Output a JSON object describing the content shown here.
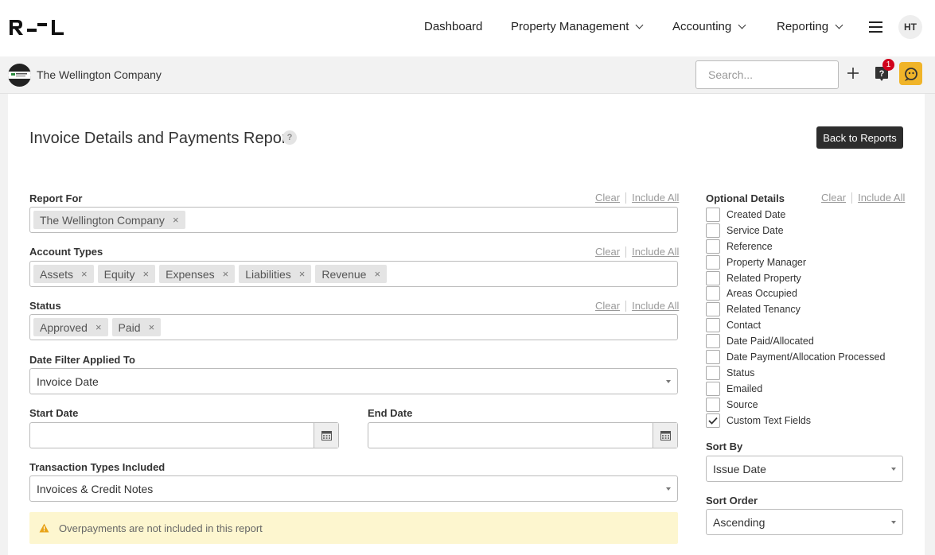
{
  "nav": {
    "items": [
      "Dashboard",
      "Property Management",
      "Accounting",
      "Reporting"
    ],
    "user_initials": "HT"
  },
  "company": {
    "name": "The Wellington Company",
    "search_placeholder": "Search...",
    "notification_count": "1"
  },
  "report": {
    "title": "Invoice Details and Payments Report",
    "help": "?",
    "back_label": "Back to Reports",
    "clear_label": "Clear",
    "include_all_label": "Include All",
    "report_for": {
      "label": "Report For",
      "tags": [
        "The Wellington Company"
      ]
    },
    "account_types": {
      "label": "Account Types",
      "tags": [
        "Assets",
        "Equity",
        "Expenses",
        "Liabilities",
        "Revenue"
      ]
    },
    "status": {
      "label": "Status",
      "tags": [
        "Approved",
        "Paid"
      ]
    },
    "date_filter": {
      "label": "Date Filter Applied To",
      "value": "Invoice Date"
    },
    "start_date": {
      "label": "Start Date",
      "value": ""
    },
    "end_date": {
      "label": "End Date",
      "value": ""
    },
    "transaction_types": {
      "label": "Transaction Types Included",
      "value": "Invoices & Credit Notes"
    },
    "alert": "Overpayments are not included in this report"
  },
  "optional_details": {
    "label": "Optional Details",
    "items": [
      {
        "label": "Created Date",
        "checked": false
      },
      {
        "label": "Service Date",
        "checked": false
      },
      {
        "label": "Reference",
        "checked": false
      },
      {
        "label": "Property Manager",
        "checked": false
      },
      {
        "label": "Related Property",
        "checked": false
      },
      {
        "label": "Areas Occupied",
        "checked": false
      },
      {
        "label": "Related Tenancy",
        "checked": false
      },
      {
        "label": "Contact",
        "checked": false
      },
      {
        "label": "Date Paid/Allocated",
        "checked": false
      },
      {
        "label": "Date Payment/Allocation Processed",
        "checked": false
      },
      {
        "label": "Status",
        "checked": false
      },
      {
        "label": "Emailed",
        "checked": false
      },
      {
        "label": "Source",
        "checked": false
      },
      {
        "label": "Custom Text Fields",
        "checked": true
      }
    ]
  },
  "sort_by": {
    "label": "Sort By",
    "value": "Issue Date"
  },
  "sort_order": {
    "label": "Sort Order",
    "value": "Ascending"
  },
  "colors": {
    "accent": "#f0b429",
    "badge": "#d0021b",
    "alert_bg": "#fdf6cf"
  }
}
